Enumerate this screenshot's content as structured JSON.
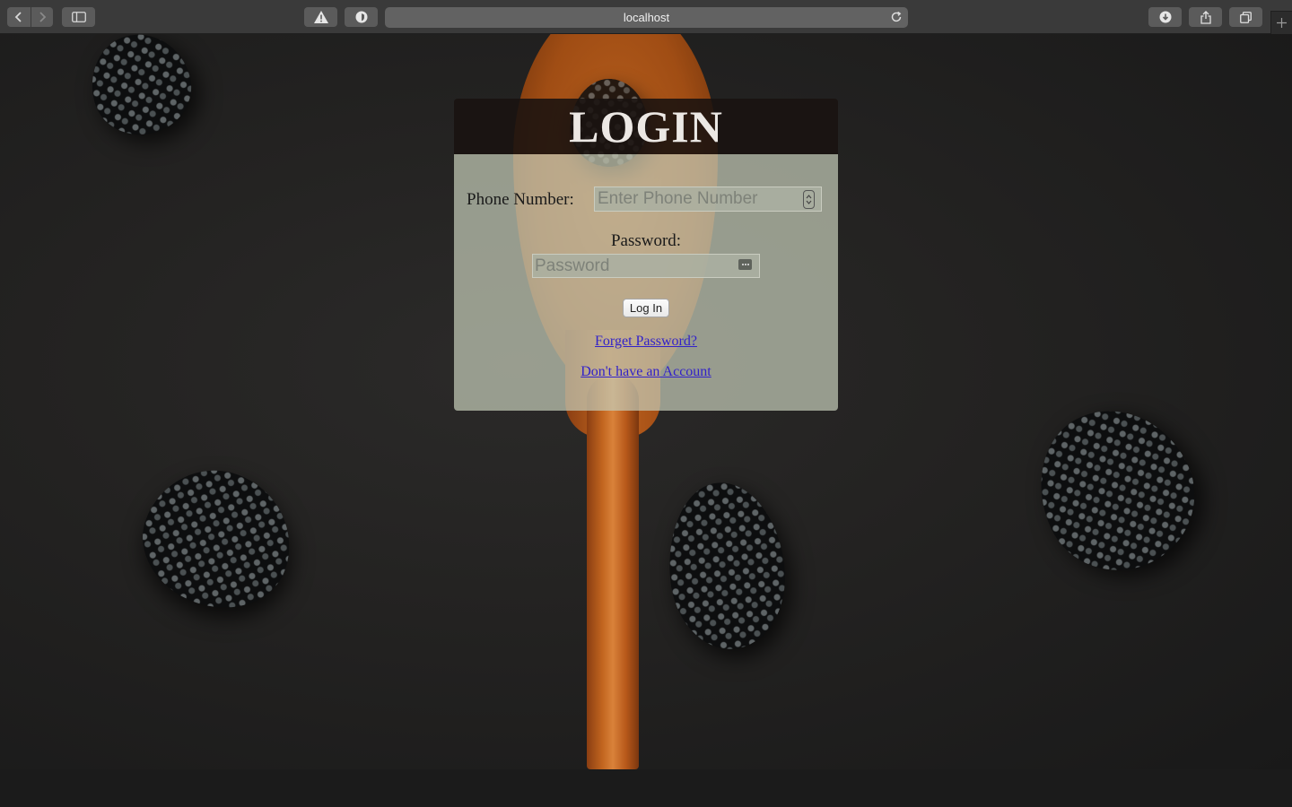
{
  "browser": {
    "url": "localhost",
    "icons": {
      "back": "chevron-left-icon",
      "forward": "chevron-right-icon",
      "sidebar": "sidebar-icon",
      "warning": "warning-icon",
      "privacy": "shield-icon",
      "reload": "reload-icon",
      "downloads": "download-icon",
      "share": "share-icon",
      "tabs": "tabs-overview-icon",
      "new_tab": "plus-icon"
    }
  },
  "login": {
    "title": "LOGIN",
    "phone_label": "Phone Number:",
    "phone_placeholder": "Enter Phone Number",
    "password_label": "Password:",
    "password_placeholder": "Password",
    "submit_label": "Log In",
    "forgot_link": "Forget Password?",
    "signup_link": "Don't have an Account"
  },
  "colors": {
    "header_bg": "#191210",
    "form_bg": "#c4cbb7",
    "link": "#3222c9",
    "title": "#ece8e4"
  }
}
